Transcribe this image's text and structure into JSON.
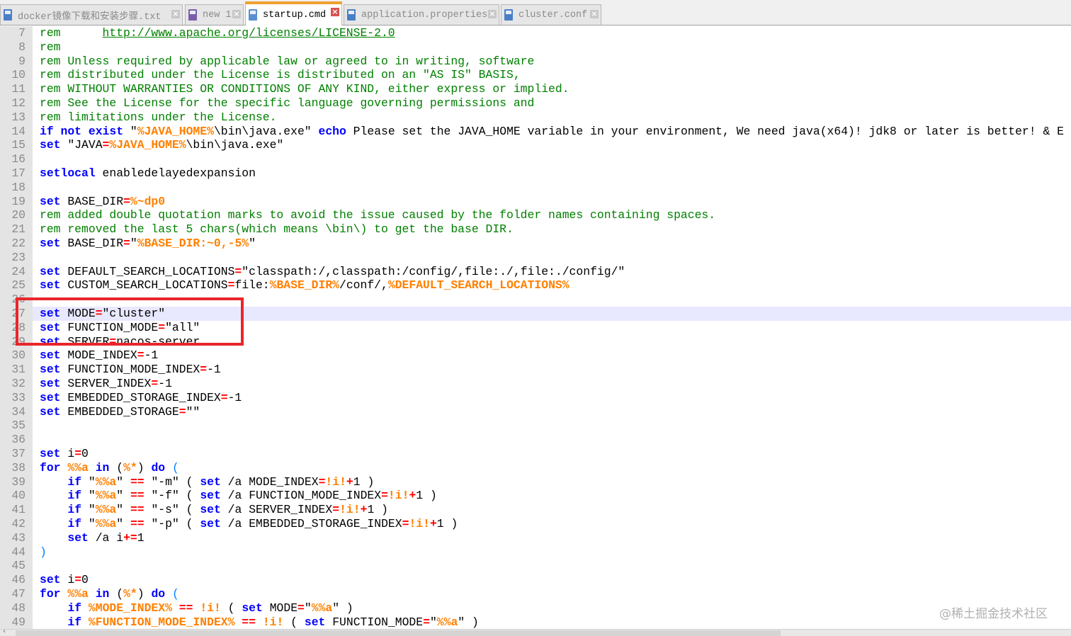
{
  "tabs": [
    {
      "label": "docker镜像下载和安装步骤.txt",
      "active": false
    },
    {
      "label": "new 1",
      "active": false
    },
    {
      "label": "startup.cmd",
      "active": true
    },
    {
      "label": "application.properties",
      "active": false
    },
    {
      "label": "cluster.conf",
      "active": false
    }
  ],
  "tab_close_glyph": "×",
  "editor": {
    "current_line": 27,
    "lines": [
      {
        "n": "7",
        "seg": [
          [
            "c",
            "rem      "
          ],
          [
            "u",
            "http://www.apache.org/licenses/LICENSE-2.0"
          ]
        ]
      },
      {
        "n": "8",
        "seg": [
          [
            "c",
            "rem"
          ]
        ]
      },
      {
        "n": "9",
        "seg": [
          [
            "c",
            "rem Unless required by applicable law or agreed to in writing, software"
          ]
        ]
      },
      {
        "n": "10",
        "seg": [
          [
            "c",
            "rem distributed under the License is distributed on an \"AS IS\" BASIS,"
          ]
        ]
      },
      {
        "n": "11",
        "seg": [
          [
            "c",
            "rem WITHOUT WARRANTIES OR CONDITIONS OF ANY KIND, either express or implied."
          ]
        ]
      },
      {
        "n": "12",
        "seg": [
          [
            "c",
            "rem See the License for the specific language governing permissions and"
          ]
        ]
      },
      {
        "n": "13",
        "seg": [
          [
            "c",
            "rem limitations under the License."
          ]
        ]
      },
      {
        "n": "14",
        "seg": [
          [
            "k",
            "if not exist"
          ],
          [
            "t",
            " \""
          ],
          [
            "v",
            "%JAVA_HOME%"
          ],
          [
            "t",
            "\\bin\\java.exe\" "
          ],
          [
            "k",
            "echo"
          ],
          [
            "t",
            " Please set the JAVA_HOME variable in your environment, We need java(x64)! jdk8 or later is better! & E"
          ]
        ]
      },
      {
        "n": "15",
        "seg": [
          [
            "k",
            "set"
          ],
          [
            "t",
            " \"JAVA"
          ],
          [
            "o",
            "="
          ],
          [
            "v",
            "%JAVA_HOME%"
          ],
          [
            "t",
            "\\bin\\java.exe\""
          ]
        ]
      },
      {
        "n": "16",
        "seg": []
      },
      {
        "n": "17",
        "seg": [
          [
            "k",
            "setlocal"
          ],
          [
            "t",
            " enabledelayedexpansion"
          ]
        ]
      },
      {
        "n": "18",
        "seg": []
      },
      {
        "n": "19",
        "seg": [
          [
            "k",
            "set"
          ],
          [
            "t",
            " BASE_DIR"
          ],
          [
            "o",
            "="
          ],
          [
            "v",
            "%~dp0"
          ]
        ]
      },
      {
        "n": "20",
        "seg": [
          [
            "c",
            "rem added double quotation marks to avoid the issue caused by the folder names containing spaces."
          ]
        ]
      },
      {
        "n": "21",
        "seg": [
          [
            "c",
            "rem removed the last 5 chars(which means \\bin\\) to get the base DIR."
          ]
        ]
      },
      {
        "n": "22",
        "seg": [
          [
            "k",
            "set"
          ],
          [
            "t",
            " BASE_DIR"
          ],
          [
            "o",
            "="
          ],
          [
            "t",
            "\""
          ],
          [
            "v",
            "%BASE_DIR:~0,-5%"
          ],
          [
            "t",
            "\""
          ]
        ]
      },
      {
        "n": "23",
        "seg": []
      },
      {
        "n": "24",
        "seg": [
          [
            "k",
            "set"
          ],
          [
            "t",
            " DEFAULT_SEARCH_LOCATIONS"
          ],
          [
            "o",
            "="
          ],
          [
            "t",
            "\"classpath:/,classpath:/config/,file:./,file:./config/\""
          ]
        ]
      },
      {
        "n": "25",
        "seg": [
          [
            "k",
            "set"
          ],
          [
            "t",
            " CUSTOM_SEARCH_LOCATIONS"
          ],
          [
            "o",
            "="
          ],
          [
            "t",
            "file:"
          ],
          [
            "v",
            "%BASE_DIR%"
          ],
          [
            "t",
            "/conf/,"
          ],
          [
            "v",
            "%DEFAULT_SEARCH_LOCATIONS%"
          ]
        ]
      },
      {
        "n": "26",
        "seg": []
      },
      {
        "n": "27",
        "seg": [
          [
            "k",
            "set"
          ],
          [
            "t",
            " MODE"
          ],
          [
            "o",
            "="
          ],
          [
            "t",
            "\"cluster\""
          ]
        ]
      },
      {
        "n": "28",
        "seg": [
          [
            "k",
            "set"
          ],
          [
            "t",
            " FUNCTION_MODE"
          ],
          [
            "o",
            "="
          ],
          [
            "t",
            "\"all\""
          ]
        ]
      },
      {
        "n": "29",
        "seg": [
          [
            "k",
            "set"
          ],
          [
            "t",
            " SERVER"
          ],
          [
            "o",
            "="
          ],
          [
            "t",
            "nacos-server"
          ]
        ]
      },
      {
        "n": "30",
        "seg": [
          [
            "k",
            "set"
          ],
          [
            "t",
            " MODE_INDEX"
          ],
          [
            "o",
            "="
          ],
          [
            "t",
            "-1"
          ]
        ]
      },
      {
        "n": "31",
        "seg": [
          [
            "k",
            "set"
          ],
          [
            "t",
            " FUNCTION_MODE_INDEX"
          ],
          [
            "o",
            "="
          ],
          [
            "t",
            "-1"
          ]
        ]
      },
      {
        "n": "32",
        "seg": [
          [
            "k",
            "set"
          ],
          [
            "t",
            " SERVER_INDEX"
          ],
          [
            "o",
            "="
          ],
          [
            "t",
            "-1"
          ]
        ]
      },
      {
        "n": "33",
        "seg": [
          [
            "k",
            "set"
          ],
          [
            "t",
            " EMBEDDED_STORAGE_INDEX"
          ],
          [
            "o",
            "="
          ],
          [
            "t",
            "-1"
          ]
        ]
      },
      {
        "n": "34",
        "seg": [
          [
            "k",
            "set"
          ],
          [
            "t",
            " EMBEDDED_STORAGE"
          ],
          [
            "o",
            "="
          ],
          [
            "t",
            "\"\""
          ]
        ]
      },
      {
        "n": "35",
        "seg": []
      },
      {
        "n": "36",
        "seg": []
      },
      {
        "n": "37",
        "seg": [
          [
            "k",
            "set"
          ],
          [
            "t",
            " i"
          ],
          [
            "o",
            "="
          ],
          [
            "t",
            "0"
          ]
        ]
      },
      {
        "n": "38",
        "seg": [
          [
            "k",
            "for"
          ],
          [
            "t",
            " "
          ],
          [
            "v",
            "%%a"
          ],
          [
            "t",
            " "
          ],
          [
            "k",
            "in"
          ],
          [
            "t",
            " ("
          ],
          [
            "v",
            "%*"
          ],
          [
            "t",
            ") "
          ],
          [
            "k",
            "do"
          ],
          [
            "t",
            " "
          ],
          [
            "p",
            "("
          ]
        ]
      },
      {
        "n": "39",
        "seg": [
          [
            "t",
            "    "
          ],
          [
            "k",
            "if"
          ],
          [
            "t",
            " \""
          ],
          [
            "v",
            "%%a"
          ],
          [
            "t",
            "\" "
          ],
          [
            "o",
            "=="
          ],
          [
            "t",
            " \"-m\" ( "
          ],
          [
            "k",
            "set"
          ],
          [
            "t",
            " /a MODE_INDEX"
          ],
          [
            "o",
            "="
          ],
          [
            "v",
            "!i!"
          ],
          [
            "o",
            "+"
          ],
          [
            "t",
            "1 )"
          ]
        ]
      },
      {
        "n": "40",
        "seg": [
          [
            "t",
            "    "
          ],
          [
            "k",
            "if"
          ],
          [
            "t",
            " \""
          ],
          [
            "v",
            "%%a"
          ],
          [
            "t",
            "\" "
          ],
          [
            "o",
            "=="
          ],
          [
            "t",
            " \"-f\" ( "
          ],
          [
            "k",
            "set"
          ],
          [
            "t",
            " /a FUNCTION_MODE_INDEX"
          ],
          [
            "o",
            "="
          ],
          [
            "v",
            "!i!"
          ],
          [
            "o",
            "+"
          ],
          [
            "t",
            "1 )"
          ]
        ]
      },
      {
        "n": "41",
        "seg": [
          [
            "t",
            "    "
          ],
          [
            "k",
            "if"
          ],
          [
            "t",
            " \""
          ],
          [
            "v",
            "%%a"
          ],
          [
            "t",
            "\" "
          ],
          [
            "o",
            "=="
          ],
          [
            "t",
            " \"-s\" ( "
          ],
          [
            "k",
            "set"
          ],
          [
            "t",
            " /a SERVER_INDEX"
          ],
          [
            "o",
            "="
          ],
          [
            "v",
            "!i!"
          ],
          [
            "o",
            "+"
          ],
          [
            "t",
            "1 )"
          ]
        ]
      },
      {
        "n": "42",
        "seg": [
          [
            "t",
            "    "
          ],
          [
            "k",
            "if"
          ],
          [
            "t",
            " \""
          ],
          [
            "v",
            "%%a"
          ],
          [
            "t",
            "\" "
          ],
          [
            "o",
            "=="
          ],
          [
            "t",
            " \"-p\" ( "
          ],
          [
            "k",
            "set"
          ],
          [
            "t",
            " /a EMBEDDED_STORAGE_INDEX"
          ],
          [
            "o",
            "="
          ],
          [
            "v",
            "!i!"
          ],
          [
            "o",
            "+"
          ],
          [
            "t",
            "1 )"
          ]
        ]
      },
      {
        "n": "43",
        "seg": [
          [
            "t",
            "    "
          ],
          [
            "k",
            "set"
          ],
          [
            "t",
            " /a i"
          ],
          [
            "o",
            "+="
          ],
          [
            "t",
            "1"
          ]
        ]
      },
      {
        "n": "44",
        "seg": [
          [
            "p",
            ")"
          ]
        ]
      },
      {
        "n": "45",
        "seg": []
      },
      {
        "n": "46",
        "seg": [
          [
            "k",
            "set"
          ],
          [
            "t",
            " i"
          ],
          [
            "o",
            "="
          ],
          [
            "t",
            "0"
          ]
        ]
      },
      {
        "n": "47",
        "seg": [
          [
            "k",
            "for"
          ],
          [
            "t",
            " "
          ],
          [
            "v",
            "%%a"
          ],
          [
            "t",
            " "
          ],
          [
            "k",
            "in"
          ],
          [
            "t",
            " ("
          ],
          [
            "v",
            "%*"
          ],
          [
            "t",
            ") "
          ],
          [
            "k",
            "do"
          ],
          [
            "t",
            " "
          ],
          [
            "p",
            "("
          ]
        ]
      },
      {
        "n": "48",
        "seg": [
          [
            "t",
            "    "
          ],
          [
            "k",
            "if"
          ],
          [
            "t",
            " "
          ],
          [
            "v",
            "%MODE_INDEX%"
          ],
          [
            "t",
            " "
          ],
          [
            "o",
            "=="
          ],
          [
            "t",
            " "
          ],
          [
            "v",
            "!i!"
          ],
          [
            "t",
            " ( "
          ],
          [
            "k",
            "set"
          ],
          [
            "t",
            " MODE"
          ],
          [
            "o",
            "="
          ],
          [
            "t",
            "\""
          ],
          [
            "v",
            "%%a"
          ],
          [
            "t",
            "\" )"
          ]
        ]
      },
      {
        "n": "49",
        "seg": [
          [
            "t",
            "    "
          ],
          [
            "k",
            "if"
          ],
          [
            "t",
            " "
          ],
          [
            "v",
            "%FUNCTION_MODE_INDEX%"
          ],
          [
            "t",
            " "
          ],
          [
            "o",
            "=="
          ],
          [
            "t",
            " "
          ],
          [
            "v",
            "!i!"
          ],
          [
            "t",
            " ( "
          ],
          [
            "k",
            "set"
          ],
          [
            "t",
            " FUNCTION_MODE"
          ],
          [
            "o",
            "="
          ],
          [
            "t",
            "\""
          ],
          [
            "v",
            "%%a"
          ],
          [
            "t",
            "\" )"
          ]
        ]
      }
    ]
  },
  "watermark": "@稀土掘金技术社区",
  "colors": {
    "keyword": "#0000ff",
    "comment": "#008000",
    "operator": "#ff0000",
    "variable": "#ff8000",
    "highlight_box": "#e8262b",
    "current_line": "#e8e8ff"
  }
}
